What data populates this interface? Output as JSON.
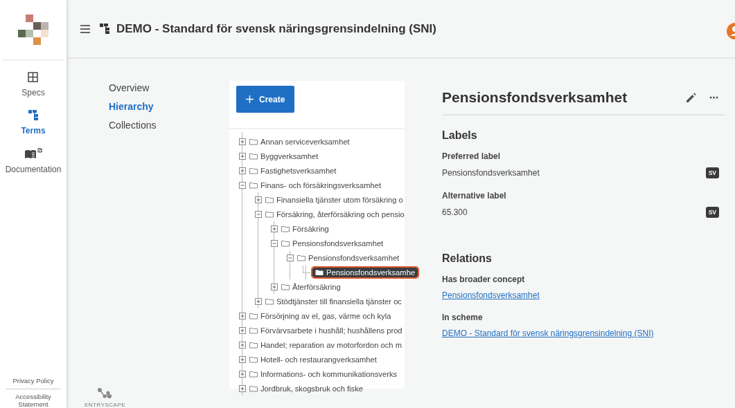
{
  "rail": {
    "items": [
      {
        "label": "Specs",
        "kind": "grid",
        "selected": false
      },
      {
        "label": "Terms",
        "kind": "tree",
        "selected": true
      },
      {
        "label": "Documentation",
        "kind": "book",
        "selected": false
      }
    ],
    "footer": [
      "Privacy Policy",
      "Accessibility Statement"
    ]
  },
  "header": {
    "title": "DEMO - Standard för svensk näringsgrensindelning (SNI)"
  },
  "subnav": [
    {
      "label": "Overview",
      "selected": false
    },
    {
      "label": "Hierarchy",
      "selected": true
    },
    {
      "label": "Collections",
      "selected": false
    }
  ],
  "brand": "ENTRYSCAPE",
  "create_button": "Create",
  "tree": [
    {
      "label": "Annan serviceverksamhet",
      "kind": "branch",
      "expanded": false,
      "selected": false
    },
    {
      "label": "Byggverksamhet",
      "kind": "branch",
      "expanded": false,
      "selected": false
    },
    {
      "label": "Fastighetsverksamhet",
      "kind": "branch",
      "expanded": false,
      "selected": false
    },
    {
      "label": "Finans- och försäkringsverksamhet",
      "kind": "branch",
      "expanded": true,
      "selected": false,
      "children": [
        {
          "label": "Finansiella tjänster utom försäkring o",
          "kind": "branch",
          "expanded": false,
          "selected": false
        },
        {
          "label": "Försäkring, återförsäkring och pensio",
          "kind": "branch",
          "expanded": true,
          "selected": false,
          "children": [
            {
              "label": "Försäkring",
              "kind": "branch",
              "expanded": false,
              "selected": false
            },
            {
              "label": "Pensionsfondsverksamhet",
              "kind": "branch",
              "expanded": true,
              "selected": false,
              "children": [
                {
                  "label": "Pensionsfondsverksamhet",
                  "kind": "branch",
                  "expanded": true,
                  "selected": false,
                  "children": [
                    {
                      "label": "Pensionsfondsverksamhe",
                      "kind": "leaf",
                      "selected": true
                    }
                  ]
                }
              ]
            },
            {
              "label": "Återförsäkring",
              "kind": "branch",
              "expanded": false,
              "selected": false
            }
          ]
        },
        {
          "label": "Stödtjänster till finansiella tjänster oc",
          "kind": "branch",
          "expanded": false,
          "selected": false
        }
      ]
    },
    {
      "label": "Försörjning av el, gas, värme och kyla",
      "kind": "branch",
      "expanded": false,
      "selected": false
    },
    {
      "label": "Förvärvsarbete i hushåll; hushållens prod",
      "kind": "branch",
      "expanded": false,
      "selected": false
    },
    {
      "label": "Handel; reparation av motorfordon och m",
      "kind": "branch",
      "expanded": false,
      "selected": false
    },
    {
      "label": "Hotell- och restaurangverksamhet",
      "kind": "branch",
      "expanded": false,
      "selected": false
    },
    {
      "label": "Informations- och kommunikationsverks",
      "kind": "branch",
      "expanded": false,
      "selected": false
    },
    {
      "label": "Jordbruk, skogsbruk och fiske",
      "kind": "branch",
      "expanded": false,
      "selected": false
    }
  ],
  "detail": {
    "title": "Pensionsfondsverksamhet",
    "sections": [
      {
        "heading": "Labels",
        "fields": [
          {
            "label": "Preferred label",
            "kind": "text",
            "value": "Pensionsfondsverksamhet",
            "lang": "SV"
          },
          {
            "label": "Alternative label",
            "kind": "text",
            "value": "65.300",
            "lang": "SV"
          }
        ]
      },
      {
        "heading": "Relations",
        "fields": [
          {
            "label": "Has broader concept",
            "kind": "link",
            "value": "Pensionsfondsverksamhet"
          },
          {
            "label": "In scheme",
            "kind": "link",
            "value": "DEMO - Standard för svensk näringsgrensindelning (SNI)"
          }
        ]
      }
    ]
  }
}
